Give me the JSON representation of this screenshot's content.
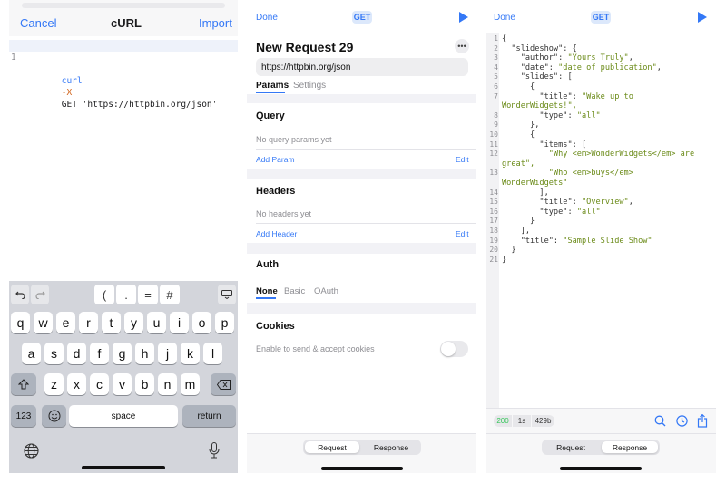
{
  "curl_panel": {
    "cancel": "Cancel",
    "title": "cURL",
    "import": "Import",
    "code_line_number": "1",
    "code_cmd": "curl",
    "code_flag": "-X",
    "code_rest": "GET 'https://httpbin.org/json'"
  },
  "keyboard": {
    "toolbar": [
      "(",
      ".",
      "=",
      "#"
    ],
    "row1": [
      "q",
      "w",
      "e",
      "r",
      "t",
      "y",
      "u",
      "i",
      "o",
      "p"
    ],
    "row2": [
      "a",
      "s",
      "d",
      "f",
      "g",
      "h",
      "j",
      "k",
      "l"
    ],
    "row3": [
      "z",
      "x",
      "c",
      "v",
      "b",
      "n",
      "m"
    ],
    "numbers_key": "123",
    "space_key": "space",
    "return_key": "return"
  },
  "request_panel": {
    "done": "Done",
    "method": "GET",
    "title": "New Request 29",
    "url": "https://httpbin.org/json",
    "tabs": [
      "Params",
      "Settings"
    ],
    "query": {
      "heading": "Query",
      "empty": "No query params yet",
      "add": "Add Param",
      "edit": "Edit"
    },
    "headers": {
      "heading": "Headers",
      "empty": "No headers yet",
      "add": "Add Header",
      "edit": "Edit"
    },
    "auth": {
      "heading": "Auth",
      "options": [
        "None",
        "Basic",
        "OAuth"
      ]
    },
    "cookies": {
      "heading": "Cookies",
      "label": "Enable to send & accept cookies",
      "enabled": false
    },
    "segment": [
      "Request",
      "Response"
    ]
  },
  "response_panel": {
    "done": "Done",
    "method": "GET",
    "lines": [
      [
        "1",
        "{"
      ],
      [
        "2",
        "  \"slideshow\": {"
      ],
      [
        "3",
        "    \"author\": \"Yours Truly\","
      ],
      [
        "4",
        "    \"date\": \"date of publication\","
      ],
      [
        "5",
        "    \"slides\": ["
      ],
      [
        "6",
        "      {"
      ],
      [
        "7",
        "        \"title\": \"Wake up to"
      ],
      [
        "",
        "WonderWidgets!\","
      ],
      [
        "8",
        "        \"type\": \"all\""
      ],
      [
        "9",
        "      },"
      ],
      [
        "10",
        "      {"
      ],
      [
        "11",
        "        \"items\": ["
      ],
      [
        "12",
        "          \"Why <em>WonderWidgets</em> are"
      ],
      [
        "",
        "great\","
      ],
      [
        "13",
        "          \"Who <em>buys</em>"
      ],
      [
        "",
        "WonderWidgets\""
      ],
      [
        "14",
        "        ],"
      ],
      [
        "15",
        "        \"title\": \"Overview\","
      ],
      [
        "16",
        "        \"type\": \"all\""
      ],
      [
        "17",
        "      }"
      ],
      [
        "18",
        "    ],"
      ],
      [
        "19",
        "    \"title\": \"Sample Slide Show\""
      ],
      [
        "20",
        "  }"
      ],
      [
        "21",
        "}"
      ]
    ],
    "status": "200",
    "time": "1s",
    "size": "429b",
    "segment": [
      "Request",
      "Response"
    ]
  },
  "colors": {
    "accent": "#3478f6",
    "string": "#6a8a17",
    "status_ok": "#34c759"
  }
}
